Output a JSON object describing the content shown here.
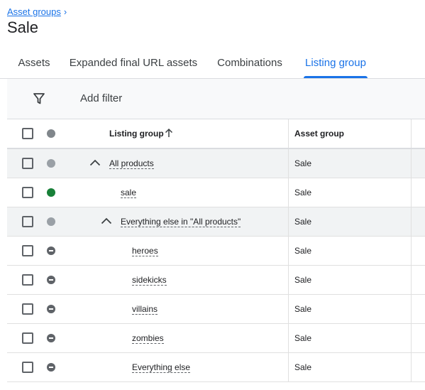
{
  "breadcrumb": {
    "parent": "Asset groups",
    "chevron": "›"
  },
  "title": "Sale",
  "tabs": [
    {
      "label": "Assets"
    },
    {
      "label": "Expanded final URL assets"
    },
    {
      "label": "Combinations"
    },
    {
      "label": "Listing group",
      "active": true
    }
  ],
  "filter": {
    "icon": "filter-funnel-icon",
    "label": "Add filter"
  },
  "table": {
    "columns": {
      "listing_group": "Listing group",
      "asset_group": "Asset group"
    },
    "sort": {
      "column": "listing_group",
      "direction": "ascending",
      "icon": "arrow-up-icon"
    },
    "rows": [
      {
        "label": "All products",
        "asset_group": "Sale",
        "status": "gray",
        "depth": 0,
        "expandable": true
      },
      {
        "label": "sale",
        "asset_group": "Sale",
        "status": "eligible",
        "depth": 1,
        "expandable": false
      },
      {
        "label": "Everything else in \"All products\"",
        "asset_group": "Sale",
        "status": "gray",
        "depth": 1,
        "expandable": true
      },
      {
        "label": "heroes",
        "asset_group": "Sale",
        "status": "excluded",
        "depth": 2,
        "expandable": false
      },
      {
        "label": "sidekicks",
        "asset_group": "Sale",
        "status": "excluded",
        "depth": 2,
        "expandable": false
      },
      {
        "label": "villains",
        "asset_group": "Sale",
        "status": "excluded",
        "depth": 2,
        "expandable": false
      },
      {
        "label": "zombies",
        "asset_group": "Sale",
        "status": "excluded",
        "depth": 2,
        "expandable": false
      },
      {
        "label": "Everything else",
        "asset_group": "Sale",
        "status": "excluded",
        "depth": 2,
        "expandable": false
      }
    ]
  },
  "colors": {
    "accent": "#1a73e8",
    "eligible": "#188038",
    "neutral": "#9aa0a6",
    "excluded": "#5f6368"
  }
}
